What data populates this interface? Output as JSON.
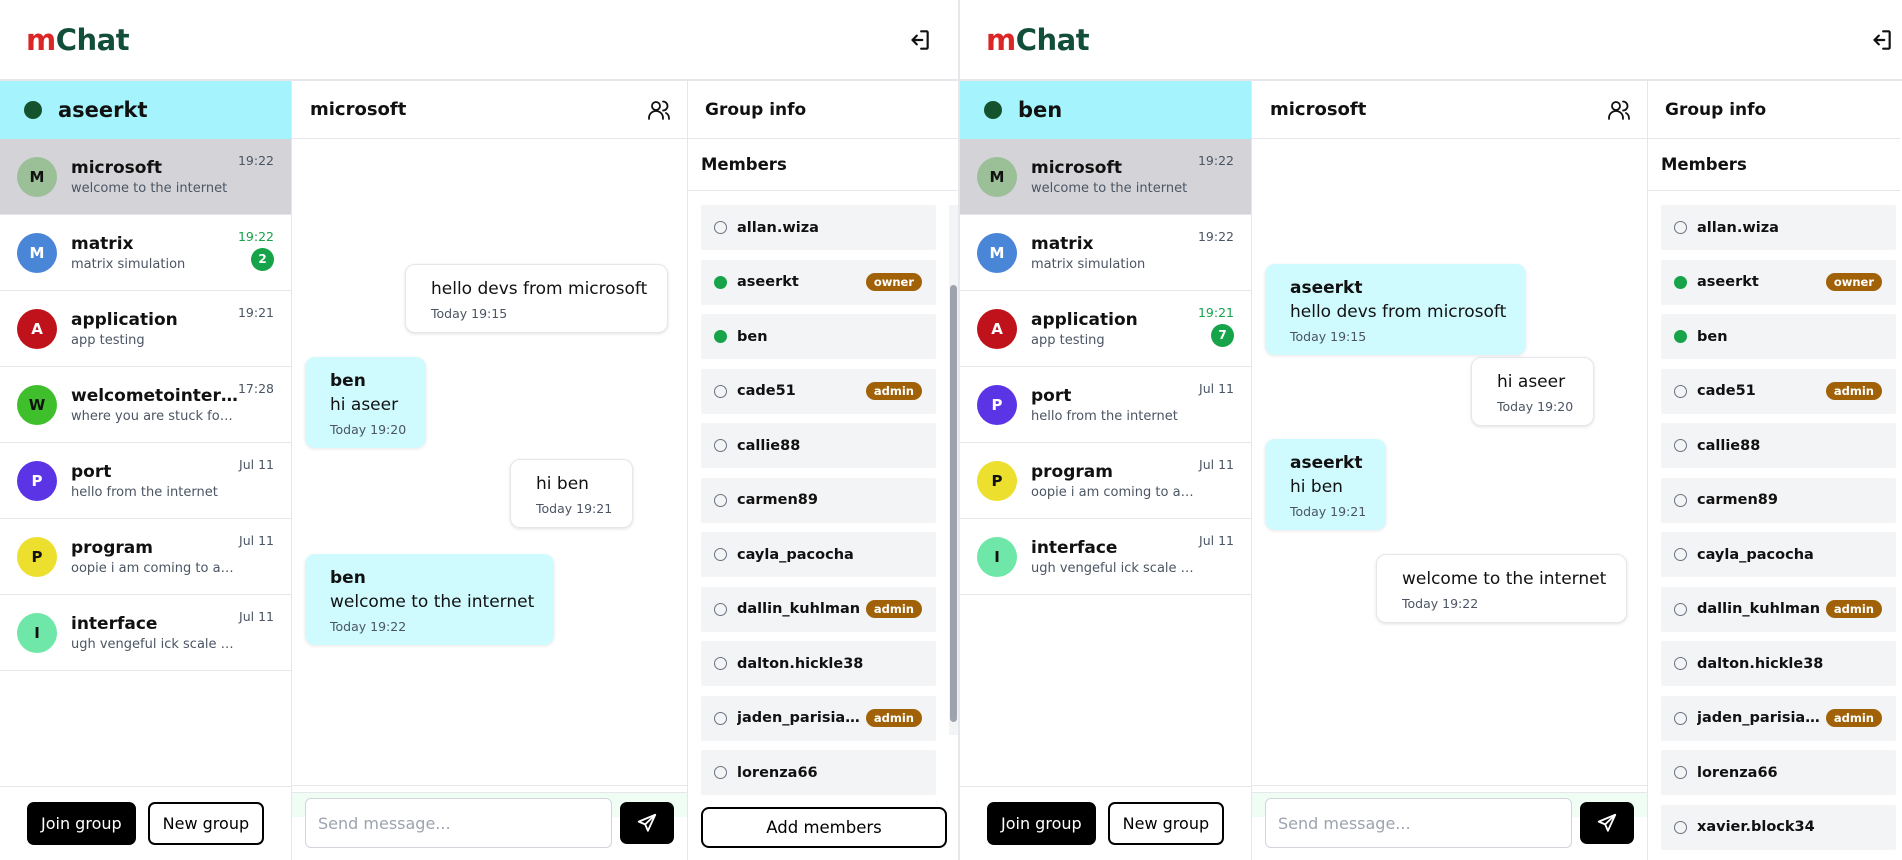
{
  "app": {
    "logo_m": "m",
    "logo_rest": "Chat"
  },
  "colors": {
    "online": "#16a34a",
    "bubble_theirs": "#cffafe",
    "user_header": "#a5f3fc",
    "role_badge": "#a16207",
    "logo_m": "#dc2626",
    "logo_rest": "#134e3a"
  },
  "left": {
    "user": "aseerkt",
    "chats": [
      {
        "initial": "M",
        "name": "microsoft",
        "last": "welcome to the internet",
        "time": "19:22",
        "avatar_bg": "#9bbf97",
        "avatar_fg": "#111111",
        "active": true
      },
      {
        "initial": "M",
        "name": "matrix",
        "last": "matrix simulation",
        "time": "19:22",
        "unread": "2",
        "avatar_bg": "#4a86d8",
        "avatar_fg": "#ffffff"
      },
      {
        "initial": "A",
        "name": "application",
        "last": "app testing",
        "time": "19:21",
        "avatar_bg": "#c0121a",
        "avatar_fg": "#ffffff"
      },
      {
        "initial": "W",
        "name": "welcometointernet...",
        "last": "where you are stuck forever",
        "time": "17:28",
        "avatar_bg": "#3fbf2c",
        "avatar_fg": "#111111"
      },
      {
        "initial": "P",
        "name": "port",
        "last": "hello from the internet",
        "time": "Jul 11",
        "avatar_bg": "#5b34e6",
        "avatar_fg": "#ffffff"
      },
      {
        "initial": "P",
        "name": "program",
        "last": "oopie i am coming to appl...",
        "time": "Jul 11",
        "avatar_bg": "#ecdf2e",
        "avatar_fg": "#111111"
      },
      {
        "initial": "I",
        "name": "interface",
        "last": "ugh vengeful ick scale coa...",
        "time": "Jul 11",
        "avatar_bg": "#6ee7a8",
        "avatar_fg": "#111111"
      }
    ],
    "join_label": "Join group",
    "new_label": "New group",
    "conversation_title": "microsoft",
    "messages": [
      {
        "mine": true,
        "text": "hello devs from microsoft",
        "time": "Today 19:15"
      },
      {
        "mine": false,
        "sender": "ben",
        "text": "hi aseer",
        "time": "Today 19:20"
      },
      {
        "mine": true,
        "text": "hi ben",
        "time": "Today 19:21"
      },
      {
        "mine": false,
        "sender": "ben",
        "text": "welcome to the internet",
        "time": "Today 19:22"
      }
    ],
    "placeholder": "Send message...",
    "group_info": "Group info",
    "members_label": "Members",
    "members": [
      {
        "name": "allan.wiza",
        "online": false
      },
      {
        "name": "aseerkt",
        "online": true,
        "role": "owner"
      },
      {
        "name": "ben",
        "online": true
      },
      {
        "name": "cade51",
        "online": false,
        "role": "admin"
      },
      {
        "name": "callie88",
        "online": false
      },
      {
        "name": "carmen89",
        "online": false
      },
      {
        "name": "cayla_pacocha",
        "online": false
      },
      {
        "name": "dallin_kuhlman",
        "online": false,
        "role": "admin"
      },
      {
        "name": "dalton.hickle38",
        "online": false
      },
      {
        "name": "jaden_parisian-h...",
        "online": false,
        "role": "admin"
      },
      {
        "name": "lorenza66",
        "online": false
      }
    ],
    "add_members": "Add members"
  },
  "right": {
    "user": "ben",
    "chats": [
      {
        "initial": "M",
        "name": "microsoft",
        "last": "welcome to the internet",
        "time": "19:22",
        "avatar_bg": "#9bbf97",
        "avatar_fg": "#111111",
        "active": true
      },
      {
        "initial": "M",
        "name": "matrix",
        "last": "matrix simulation",
        "time": "19:22",
        "avatar_bg": "#4a86d8",
        "avatar_fg": "#ffffff"
      },
      {
        "initial": "A",
        "name": "application",
        "last": "app testing",
        "time": "19:21",
        "unread": "7",
        "avatar_bg": "#c0121a",
        "avatar_fg": "#ffffff"
      },
      {
        "initial": "P",
        "name": "port",
        "last": "hello from the internet",
        "time": "Jul 11",
        "avatar_bg": "#5b34e6",
        "avatar_fg": "#ffffff"
      },
      {
        "initial": "P",
        "name": "program",
        "last": "oopie i am coming to appl...",
        "time": "Jul 11",
        "avatar_bg": "#ecdf2e",
        "avatar_fg": "#111111"
      },
      {
        "initial": "I",
        "name": "interface",
        "last": "ugh vengeful ick scale coa...",
        "time": "Jul 11",
        "avatar_bg": "#6ee7a8",
        "avatar_fg": "#111111"
      }
    ],
    "join_label": "Join group",
    "new_label": "New group",
    "conversation_title": "microsoft",
    "messages": [
      {
        "mine": false,
        "sender": "aseerkt",
        "text": "hello devs from microsoft",
        "time": "Today 19:15"
      },
      {
        "mine": true,
        "text": "hi aseer",
        "time": "Today 19:20"
      },
      {
        "mine": false,
        "sender": "aseerkt",
        "text": "hi ben",
        "time": "Today 19:21"
      },
      {
        "mine": true,
        "text": "welcome to the internet",
        "time": "Today 19:22"
      }
    ],
    "placeholder": "Send message...",
    "group_info": "Group info",
    "members_label": "Members",
    "members": [
      {
        "name": "allan.wiza",
        "online": false
      },
      {
        "name": "aseerkt",
        "online": true,
        "role": "owner"
      },
      {
        "name": "ben",
        "online": true
      },
      {
        "name": "cade51",
        "online": false,
        "role": "admin"
      },
      {
        "name": "callie88",
        "online": false
      },
      {
        "name": "carmen89",
        "online": false
      },
      {
        "name": "cayla_pacocha",
        "online": false
      },
      {
        "name": "dallin_kuhlman",
        "online": false,
        "role": "admin"
      },
      {
        "name": "dalton.hickle38",
        "online": false
      },
      {
        "name": "jaden_parisian-h...",
        "online": false,
        "role": "admin"
      },
      {
        "name": "lorenza66",
        "online": false
      },
      {
        "name": "xavier.block34",
        "online": false
      }
    ]
  }
}
